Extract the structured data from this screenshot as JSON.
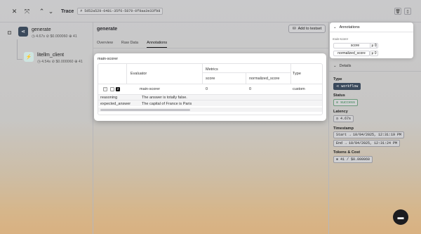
{
  "header": {
    "title": "Trace",
    "trace_id": "# 5d52a529-6481-35f6-5879-0f9aa3e33fb8"
  },
  "tree": {
    "items": [
      {
        "name": "generate",
        "duration": "4.67s",
        "cost": "$0.000060",
        "tokens": "41"
      },
      {
        "name": "litellm_client",
        "duration": "4.54s",
        "cost": "$0.000060",
        "tokens": "41"
      }
    ]
  },
  "detail": {
    "title": "generate",
    "add_to_testset": "Add to testset",
    "tabs": [
      "Overview",
      "Raw Data",
      "Annotations"
    ],
    "active_tab": "Annotations"
  },
  "modal": {
    "title": "main-scorer",
    "headers": {
      "evaluator": "Evaluator",
      "metrics": "Metrics",
      "score": "score",
      "normalized_score": "normalized_score",
      "type": "Type"
    },
    "row": {
      "evaluator": "main-scorer",
      "score": "0",
      "normalized_score": "0",
      "type": "custom",
      "count": "2"
    },
    "expanded": [
      {
        "key": "reasoning",
        "value": "The answer is totally false."
      },
      {
        "key": "expected_answer",
        "value": "The capital of France is Paris"
      }
    ]
  },
  "annotations": {
    "title": "Annotations",
    "evaluator": "main-scorer",
    "metrics": [
      {
        "name": "score",
        "value": "μ 0"
      },
      {
        "name": "normalized_score",
        "value": "μ 0"
      }
    ]
  },
  "details": {
    "title": "Details",
    "type_label": "Type",
    "type_value": "workflow",
    "status_label": "Status",
    "status_value": "success",
    "latency_label": "Latency",
    "latency_value": "4.67s",
    "timestamp_label": "Timestamp",
    "start": "Start → 10/04/2025, 12:31:19 PM",
    "end": "End → 10/04/2025, 12:31:24 PM",
    "tokens_label": "Tokens & Cost",
    "tokens_value": "41 / $0.000060"
  },
  "colors": {
    "accent_icon": "#3b4a5c",
    "status_green": "#2f7d4a",
    "tree_child": "#cde4e0"
  }
}
